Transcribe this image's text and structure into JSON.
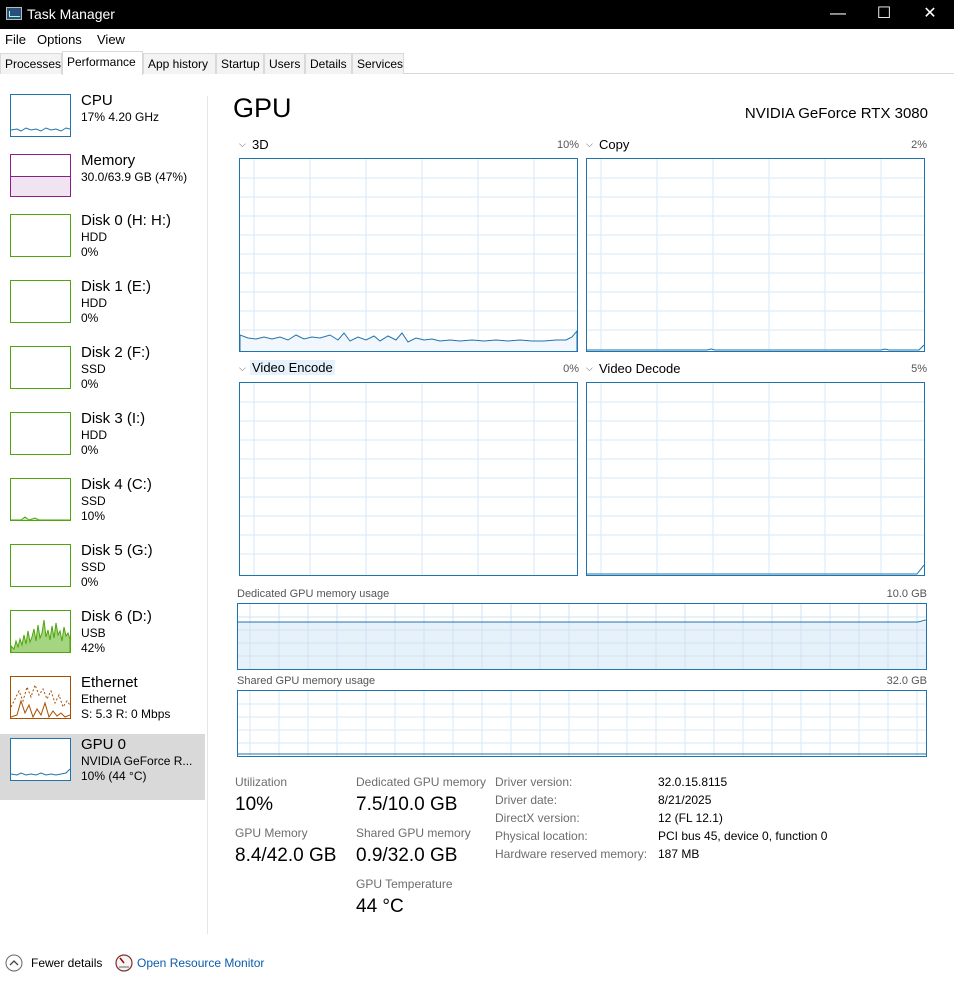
{
  "window": {
    "title": "Task Manager",
    "minimize": "—",
    "maximize": "☐",
    "close": "✕"
  },
  "menu": [
    "File",
    "Options",
    "View"
  ],
  "tabs": [
    "Processes",
    "Performance",
    "App history",
    "Startup",
    "Users",
    "Details",
    "Services"
  ],
  "active_tab": "Performance",
  "sidebar": [
    {
      "title": "CPU",
      "sub1": "17%  4.20 GHz",
      "sub2": "",
      "color": "#1f74ad"
    },
    {
      "title": "Memory",
      "sub1": "30.0/63.9 GB (47%)",
      "sub2": "",
      "color": "#8b1e8b"
    },
    {
      "title": "Disk 0 (H: H:)",
      "sub1": "HDD",
      "sub2": "0%",
      "color": "#4da60c"
    },
    {
      "title": "Disk 1 (E:)",
      "sub1": "HDD",
      "sub2": "0%",
      "color": "#4da60c"
    },
    {
      "title": "Disk 2 (F:)",
      "sub1": "SSD",
      "sub2": "0%",
      "color": "#4da60c"
    },
    {
      "title": "Disk 3 (I:)",
      "sub1": "HDD",
      "sub2": "0%",
      "color": "#4da60c"
    },
    {
      "title": "Disk 4 (C:)",
      "sub1": "SSD",
      "sub2": "10%",
      "color": "#4da60c"
    },
    {
      "title": "Disk 5 (G:)",
      "sub1": "SSD",
      "sub2": "0%",
      "color": "#4da60c"
    },
    {
      "title": "Disk 6 (D:)",
      "sub1": "USB",
      "sub2": "42%",
      "color": "#4da60c"
    },
    {
      "title": "Ethernet",
      "sub1": "Ethernet",
      "sub2": "S: 5.3  R: 0 Mbps",
      "color": "#a74f01"
    },
    {
      "title": "GPU 0",
      "sub1": "NVIDIA GeForce R...",
      "sub2": "10%  (44 °C)",
      "color": "#1f74ad"
    }
  ],
  "gpu": {
    "heading": "GPU",
    "model": "NVIDIA GeForce RTX 3080",
    "engines": [
      {
        "name": "3D",
        "percent": "10%"
      },
      {
        "name": "Copy",
        "percent": "2%"
      },
      {
        "name": "Video Encode",
        "percent": "0%"
      },
      {
        "name": "Video Decode",
        "percent": "5%"
      }
    ],
    "dedicated_graph": {
      "label": "Dedicated GPU memory usage",
      "max": "10.0 GB"
    },
    "shared_graph": {
      "label": "Shared GPU memory usage",
      "max": "32.0 GB"
    },
    "stats": {
      "utilization_label": "Utilization",
      "utilization": "10%",
      "gpu_memory_label": "GPU Memory",
      "gpu_memory": "8.4/42.0 GB",
      "dedicated_label": "Dedicated GPU memory",
      "dedicated": "7.5/10.0 GB",
      "shared_label": "Shared GPU memory",
      "shared": "0.9/32.0 GB",
      "temp_label": "GPU Temperature",
      "temp": "44 °C"
    },
    "details": [
      {
        "label": "Driver version:",
        "value": "32.0.15.8115"
      },
      {
        "label": "Driver date:",
        "value": "8/21/2025"
      },
      {
        "label": "DirectX version:",
        "value": "12 (FL 12.1)"
      },
      {
        "label": "Physical location:",
        "value": "PCI bus 45, device 0, function 0"
      },
      {
        "label": "Hardware reserved memory:",
        "value": "187 MB"
      }
    ]
  },
  "footer": {
    "fewer_details": "Fewer details",
    "open_resource_monitor": "Open Resource Monitor"
  }
}
